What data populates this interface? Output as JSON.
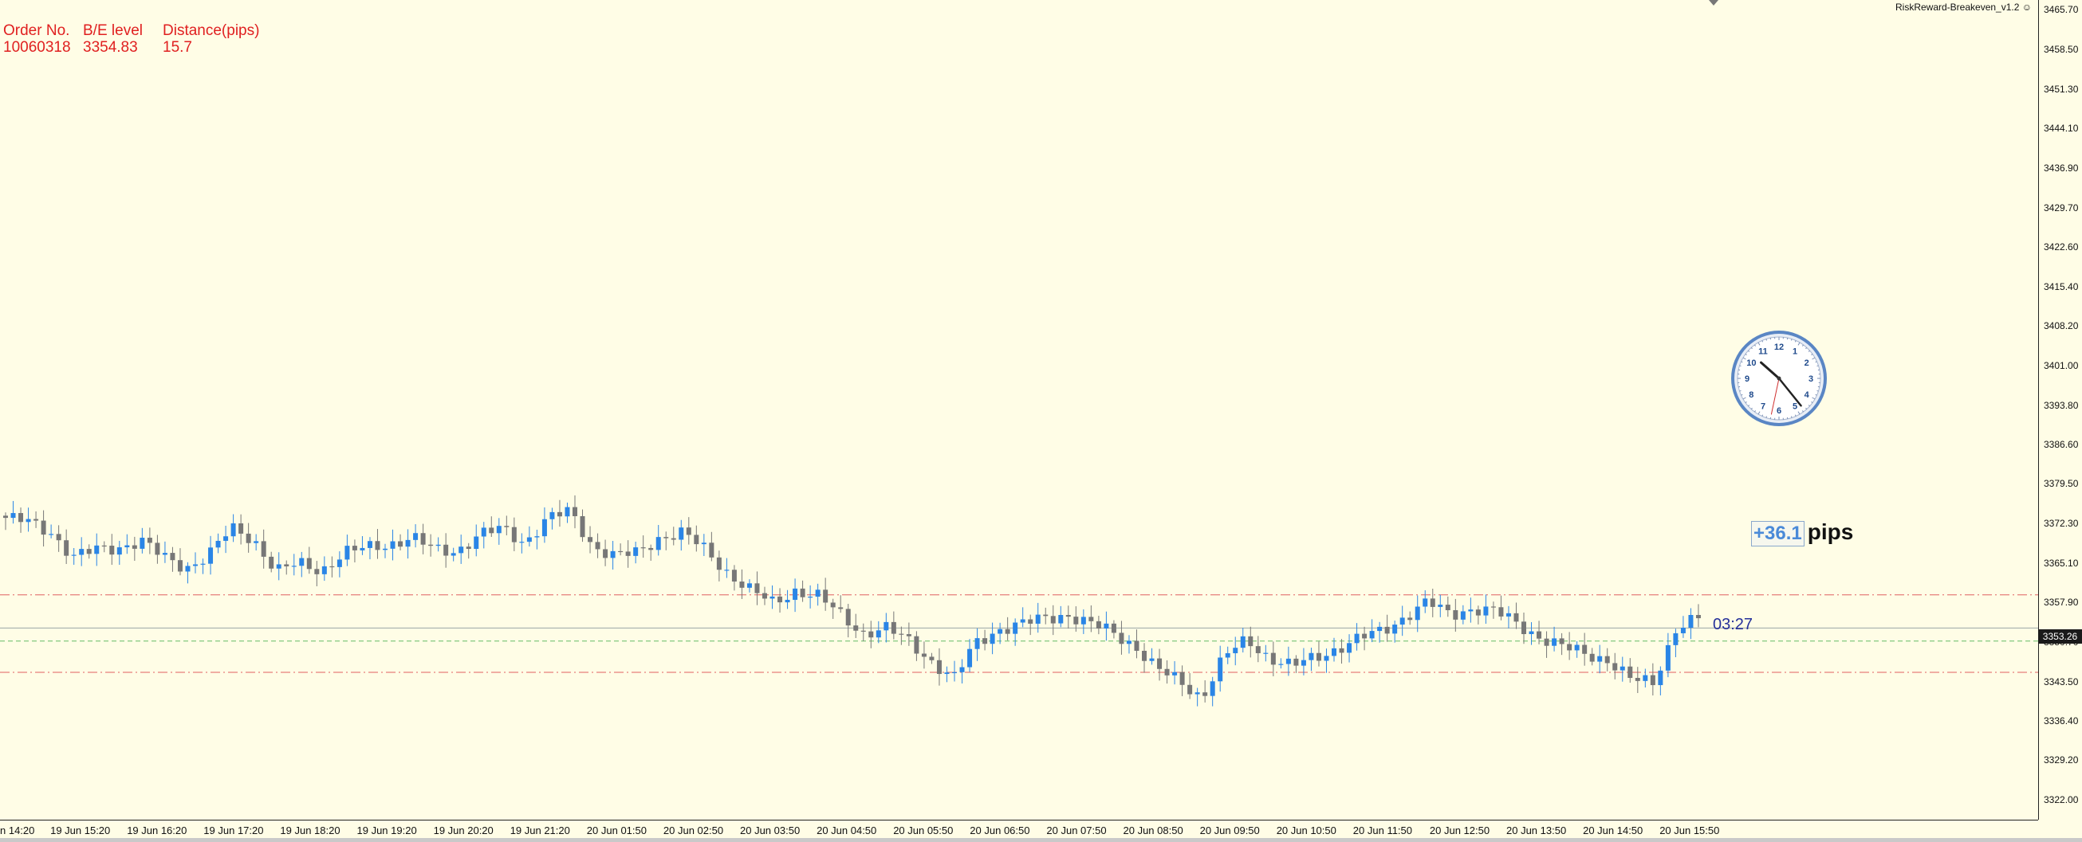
{
  "info_panel": {
    "columns": [
      {
        "header": "Order No.",
        "value": "10060318"
      },
      {
        "header": "B/E level",
        "value": "3354.83"
      },
      {
        "header": "Distance(pips)",
        "value": "15.7"
      }
    ]
  },
  "indicator_name": "RiskReward-Breakeven_v1.2 ☺",
  "price_axis": {
    "labels": [
      "3465.70",
      "3458.50",
      "3451.30",
      "3444.10",
      "3436.90",
      "3429.70",
      "3422.60",
      "3415.40",
      "3408.20",
      "3401.00",
      "3393.80",
      "3386.60",
      "3379.50",
      "3372.30",
      "3365.10",
      "3357.90",
      "3350.70",
      "3343.50",
      "3336.40",
      "3329.20",
      "3322.00"
    ],
    "current_price": "3353.26"
  },
  "time_axis": {
    "labels": [
      "n 14:20",
      "19 Jun 15:20",
      "19 Jun 16:20",
      "19 Jun 17:20",
      "19 Jun 18:20",
      "19 Jun 19:20",
      "19 Jun 20:20",
      "19 Jun 21:20",
      "20 Jun 01:50",
      "20 Jun 02:50",
      "20 Jun 03:50",
      "20 Jun 04:50",
      "20 Jun 05:50",
      "20 Jun 06:50",
      "20 Jun 07:50",
      "20 Jun 08:50",
      "20 Jun 09:50",
      "20 Jun 10:50",
      "20 Jun 11:50",
      "20 Jun 12:50",
      "20 Jun 13:50",
      "20 Jun 14:50",
      "20 Jun 15:50"
    ]
  },
  "countdown": "03:27",
  "pips_display": {
    "value": "+36.1",
    "unit": "pips"
  },
  "clock": {
    "numerals": [
      "12",
      "1",
      "2",
      "3",
      "4",
      "5",
      "6",
      "7",
      "8",
      "9",
      "10",
      "11"
    ],
    "time_shown": "10:23:32"
  },
  "levels": {
    "upper_dashed_red": 3359.3,
    "green_dashed": 3350.9,
    "lower_dashed_red": 3345.2,
    "current_price_line": 3353.26
  },
  "colors": {
    "background": "#fffde6",
    "bull": "#2a85e6",
    "bear": "#777777",
    "info_text": "#e02020",
    "level_red": "#e06060",
    "level_green": "#66bb66",
    "countdown": "#25309a"
  },
  "chart_data": {
    "type": "candlestick",
    "ylim": [
      3318.4,
      3467.5
    ],
    "candle_count": 224,
    "anchor_closes": [
      3373.3,
      3372.5,
      3370.8,
      3366.2,
      3367.4,
      3368.0,
      3369.2,
      3366.0,
      3364.3,
      3366.6,
      3371.3,
      3369.4,
      3363.6,
      3364.9,
      3363.8,
      3366.9,
      3367.8,
      3368.6,
      3369.7,
      3367.4,
      3367.4,
      3370.2,
      3371.3,
      3368.9,
      3373.1,
      3374.5,
      3368.3,
      3366.3,
      3366.9,
      3369.9,
      3370.6,
      3367.4,
      3363.4,
      3360.1,
      3357.7,
      3360.2,
      3359.0,
      3355.6,
      3352.4,
      3353.2,
      3350.9,
      3347.4,
      3343.9,
      3350.6,
      3353.1,
      3353.9,
      3355.0,
      3355.8,
      3354.0,
      3352.6,
      3350.2,
      3345.7,
      3343.6,
      3340.7,
      3348.1,
      3351.1,
      3347.9,
      3346.2,
      3347.9,
      3349.6,
      3351.3,
      3352.8,
      3355.4,
      3357.9,
      3355.7,
      3356.9,
      3356.2,
      3354.0,
      3351.6,
      3349.7,
      3348.6,
      3347.5,
      3343.8,
      3343.3,
      3353.3,
      3355.0
    ],
    "ohlc": []
  }
}
